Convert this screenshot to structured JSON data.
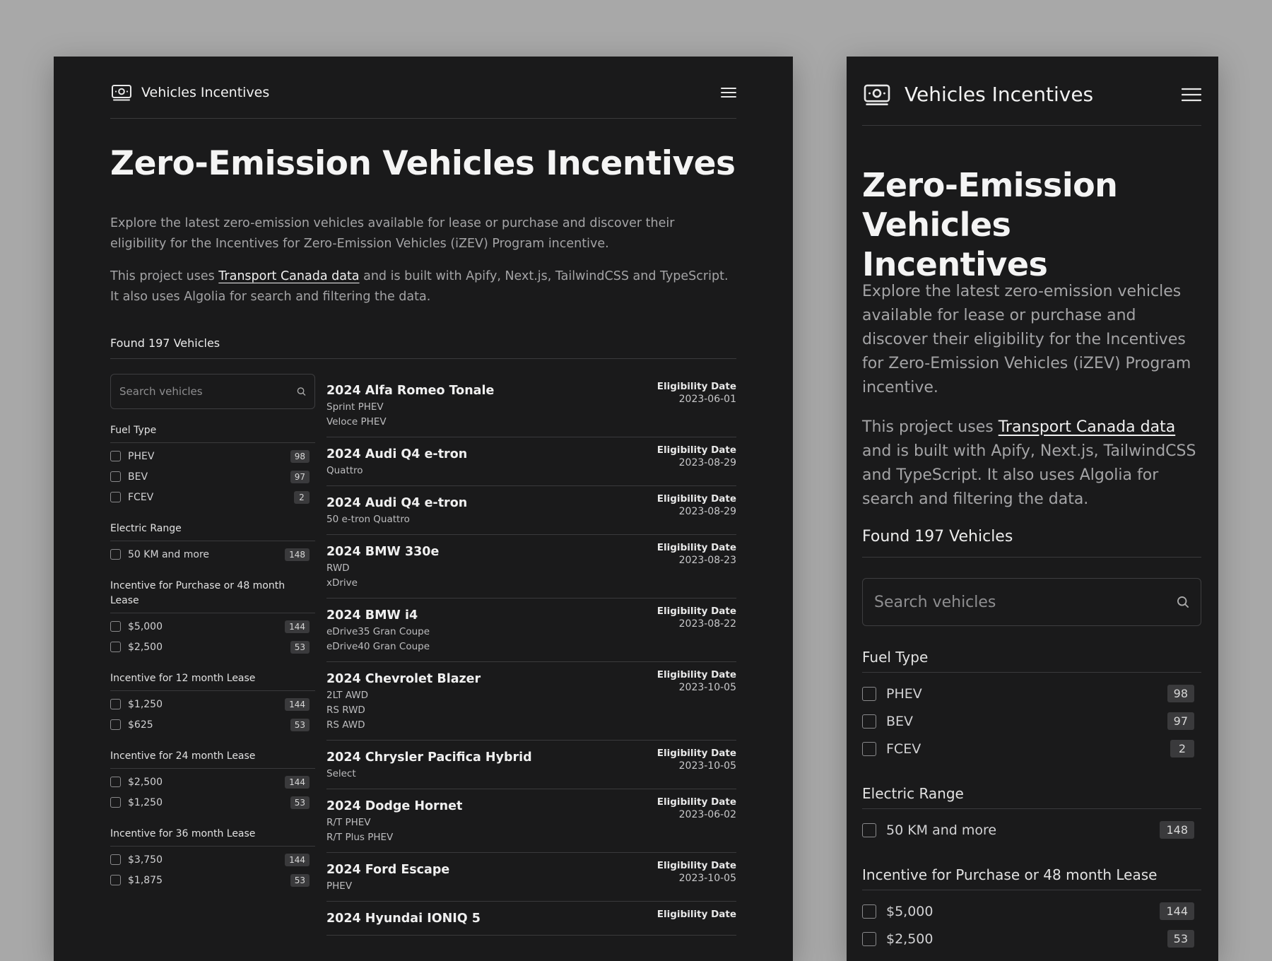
{
  "app": {
    "brand": "Vehicles Incentives"
  },
  "hero": {
    "title": "Zero-Emission Vehicles Incentives",
    "intro": "Explore the latest zero-emission vehicles available for lease or purchase and discover their eligibility for the Incentives for Zero-Emission Vehicles (iZEV) Program incentive.",
    "project_before": "This project uses ",
    "project_link": "Transport Canada data",
    "project_after": " and is built with Apify, Next.js, TailwindCSS and TypeScript. It also uses Algolia for search and filtering the data."
  },
  "results": {
    "found": "Found 197 Vehicles"
  },
  "search": {
    "placeholder": "Search vehicles"
  },
  "filters": [
    {
      "title": "Fuel Type",
      "options": [
        {
          "label": "PHEV",
          "count": "98"
        },
        {
          "label": "BEV",
          "count": "97"
        },
        {
          "label": "FCEV",
          "count": "2"
        }
      ]
    },
    {
      "title": "Electric Range",
      "options": [
        {
          "label": "50 KM and more",
          "count": "148"
        }
      ]
    },
    {
      "title": "Incentive for Purchase or 48 month Lease",
      "options": [
        {
          "label": "$5,000",
          "count": "144"
        },
        {
          "label": "$2,500",
          "count": "53"
        }
      ]
    },
    {
      "title": "Incentive for 12 month Lease",
      "options": [
        {
          "label": "$1,250",
          "count": "144"
        },
        {
          "label": "$625",
          "count": "53"
        }
      ]
    },
    {
      "title": "Incentive for 24 month Lease",
      "options": [
        {
          "label": "$2,500",
          "count": "144"
        },
        {
          "label": "$1,250",
          "count": "53"
        }
      ]
    },
    {
      "title": "Incentive for 36 month Lease",
      "options": [
        {
          "label": "$3,750",
          "count": "144"
        },
        {
          "label": "$1,875",
          "count": "53"
        }
      ]
    }
  ],
  "eligibility_label": "Eligibility Date",
  "vehicles": [
    {
      "name": "2024 Alfa Romeo Tonale",
      "trims": [
        "Sprint PHEV",
        "Veloce PHEV"
      ],
      "date": "2023-06-01"
    },
    {
      "name": "2024 Audi Q4 e-tron",
      "trims": [
        "Quattro"
      ],
      "date": "2023-08-29"
    },
    {
      "name": "2024 Audi Q4 e-tron",
      "trims": [
        "50 e-tron Quattro"
      ],
      "date": "2023-08-29"
    },
    {
      "name": "2024 BMW 330e",
      "trims": [
        "RWD",
        "xDrive"
      ],
      "date": "2023-08-23"
    },
    {
      "name": "2024 BMW i4",
      "trims": [
        "eDrive35 Gran Coupe",
        "eDrive40 Gran Coupe"
      ],
      "date": "2023-08-22"
    },
    {
      "name": "2024 Chevrolet Blazer",
      "trims": [
        "2LT AWD",
        "RS RWD",
        "RS AWD"
      ],
      "date": "2023-10-05"
    },
    {
      "name": "2024 Chrysler Pacifica Hybrid",
      "trims": [
        "Select"
      ],
      "date": "2023-10-05"
    },
    {
      "name": "2024 Dodge Hornet",
      "trims": [
        "R/T PHEV",
        "R/T Plus PHEV"
      ],
      "date": "2023-06-02"
    },
    {
      "name": "2024 Ford Escape",
      "trims": [
        "PHEV"
      ],
      "date": "2023-10-05"
    },
    {
      "name": "2024 Hyundai IONIQ 5",
      "trims": [],
      "date": ""
    }
  ]
}
